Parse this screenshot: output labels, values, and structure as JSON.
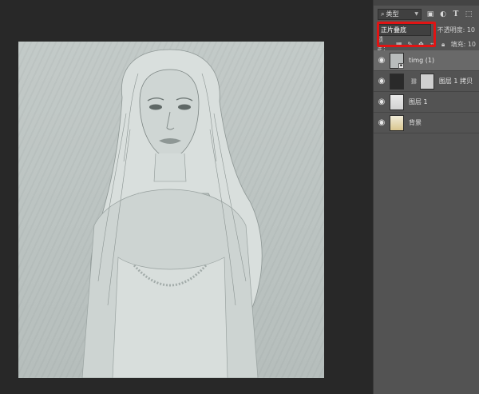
{
  "panel": {
    "filter": {
      "kind_label": "类型",
      "kind_icon": "search-icon"
    },
    "blend_mode": "正片叠底",
    "opacity_label": "不透明度: 10",
    "lock_label": "锁定:",
    "fill_label": "填充: 10"
  },
  "layers": [
    {
      "name": "timg (1)",
      "thumb": "gray",
      "selected": true,
      "smart_object": true
    },
    {
      "name": "图层 1 拷贝",
      "thumb": "dark",
      "has_mask": true
    },
    {
      "name": "图层 1",
      "thumb": "sketch"
    },
    {
      "name": "背景",
      "thumb": "photo"
    }
  ],
  "colors": {
    "highlight": "#e01414",
    "panel_bg": "#535353",
    "workspace_bg": "#282828"
  }
}
